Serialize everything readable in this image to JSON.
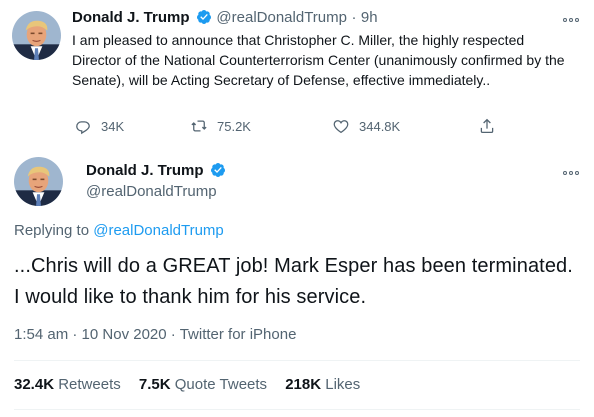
{
  "tweet1": {
    "author_name": "Donald J. Trump",
    "handle": "@realDonaldTrump",
    "separator": "·",
    "time": "9h",
    "text": "I am pleased to announce that Christopher C. Miller, the highly respected Director of the National Counterterrorism Center (unanimously confirmed by the Senate), will be Acting Secretary of Defense, effective immediately..",
    "replies": "34K",
    "retweets": "75.2K",
    "likes": "344.8K"
  },
  "tweet2": {
    "author_name": "Donald J. Trump",
    "handle": "@realDonaldTrump",
    "replying_prefix": "Replying to ",
    "replying_to": "@realDonaldTrump",
    "text": "...Chris will do a GREAT job! Mark Esper has been terminated. I would like to thank him for his service.",
    "time": "1:54 am",
    "date": "10 Nov 2020",
    "source": "Twitter for iPhone",
    "meta_separator": "·",
    "retweets_count": "32.4K",
    "retweets_label": "Retweets",
    "quotes_count": "7.5K",
    "quotes_label": "Quote Tweets",
    "likes_count": "218K",
    "likes_label": "Likes"
  },
  "colors": {
    "accent": "#1d9bf0",
    "text": "#0f1419",
    "muted": "#536471",
    "divider": "#eff3f4"
  },
  "icons": {
    "verified": "verified-badge-icon",
    "reply": "reply-icon",
    "retweet": "retweet-icon",
    "like": "heart-icon",
    "share": "share-icon",
    "more": "more-options-icon"
  }
}
